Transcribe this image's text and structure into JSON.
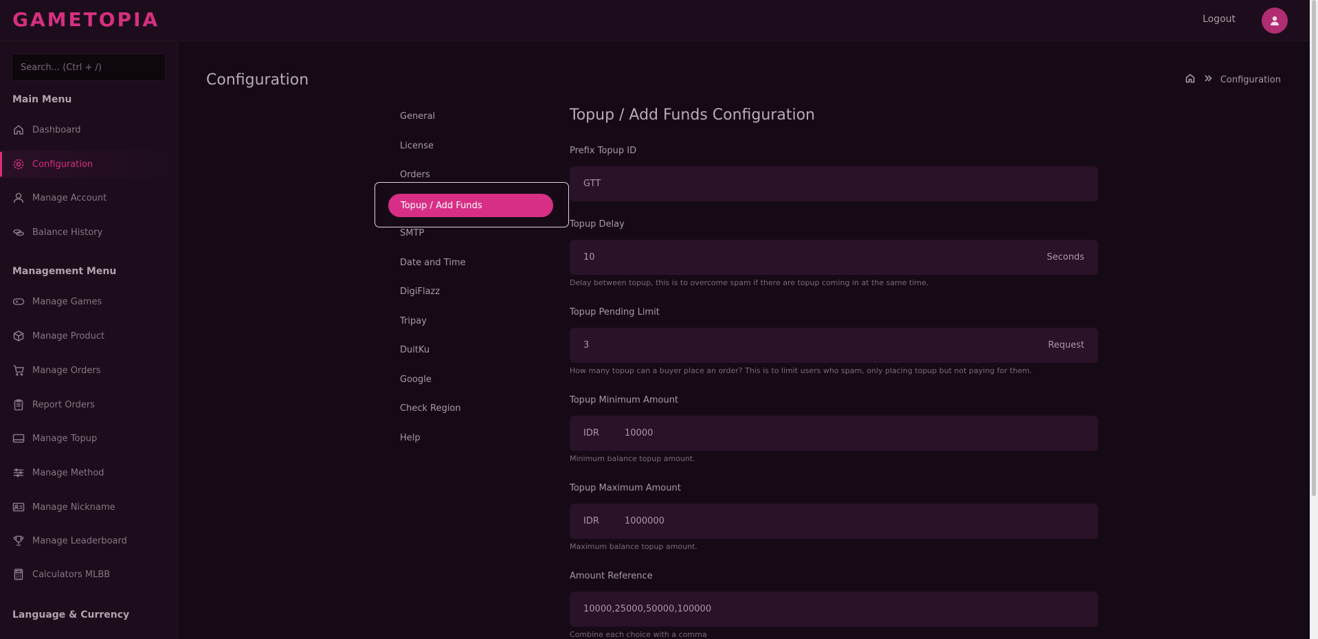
{
  "app": {
    "logo": "GAMETOPIA",
    "logout": "Logout"
  },
  "sidebar": {
    "search_placeholder": "Search... (Ctrl + /)",
    "main_heading": "Main Menu",
    "main_items": [
      {
        "label": "Dashboard",
        "icon": "home-icon"
      },
      {
        "label": "Configuration",
        "icon": "gear-icon",
        "active": true
      },
      {
        "label": "Manage Account",
        "icon": "user-icon"
      },
      {
        "label": "Balance History",
        "icon": "coins-icon"
      }
    ],
    "management_heading": "Management Menu",
    "management_items": [
      {
        "label": "Manage Games",
        "icon": "gamepad-icon"
      },
      {
        "label": "Manage Product",
        "icon": "box-icon"
      },
      {
        "label": "Manage Orders",
        "icon": "cart-icon"
      },
      {
        "label": "Report Orders",
        "icon": "clipboard-icon"
      },
      {
        "label": "Manage Topup",
        "icon": "card-icon"
      },
      {
        "label": "Manage Method",
        "icon": "sliders-icon"
      },
      {
        "label": "Manage Nickname",
        "icon": "id-card-icon"
      },
      {
        "label": "Manage Leaderboard",
        "icon": "trophy-icon"
      },
      {
        "label": "Calculators MLBB",
        "icon": "calculator-icon"
      }
    ],
    "language_heading": "Language & Currency"
  },
  "header": {
    "title": "Configuration",
    "breadcrumb_current": "Configuration"
  },
  "config_nav": {
    "items": [
      "General",
      "License",
      "Orders",
      "Topup / Add Funds",
      "SMTP",
      "Date and Time",
      "DigiFlazz",
      "Tripay",
      "DuitKu",
      "Google",
      "Check Region",
      "Help"
    ],
    "active": "Topup / Add Funds"
  },
  "form": {
    "title": "Topup / Add Funds Configuration",
    "prefix_label": "Prefix Topup ID",
    "prefix_value": "GTT",
    "delay_label": "Topup Delay",
    "delay_value": "10",
    "delay_suffix": "Seconds",
    "delay_help": "Delay between topup, this is to overcome spam if there are topup coming in at the same time.",
    "pending_label": "Topup Pending Limit",
    "pending_value": "3",
    "pending_suffix": "Request",
    "pending_help": "How many topup can a buyer place an order? This is to limit users who spam, only placing topup but not paying for them.",
    "min_label": "Topup Minimum Amount",
    "min_currency": "IDR",
    "min_value": "10000",
    "min_help": "Minimum balance topup amount.",
    "max_label": "Topup Maximum Amount",
    "max_currency": "IDR",
    "max_value": "1000000",
    "max_help": "Maximum balance topup amount.",
    "ref_label": "Amount Reference",
    "ref_value": "10000,25000,50000,100000",
    "ref_help": "Combine each choice with a comma"
  },
  "colors": {
    "accent": "#d6307f",
    "background": "#170a17",
    "panel": "#1d0d1c",
    "field": "#2a1228"
  }
}
